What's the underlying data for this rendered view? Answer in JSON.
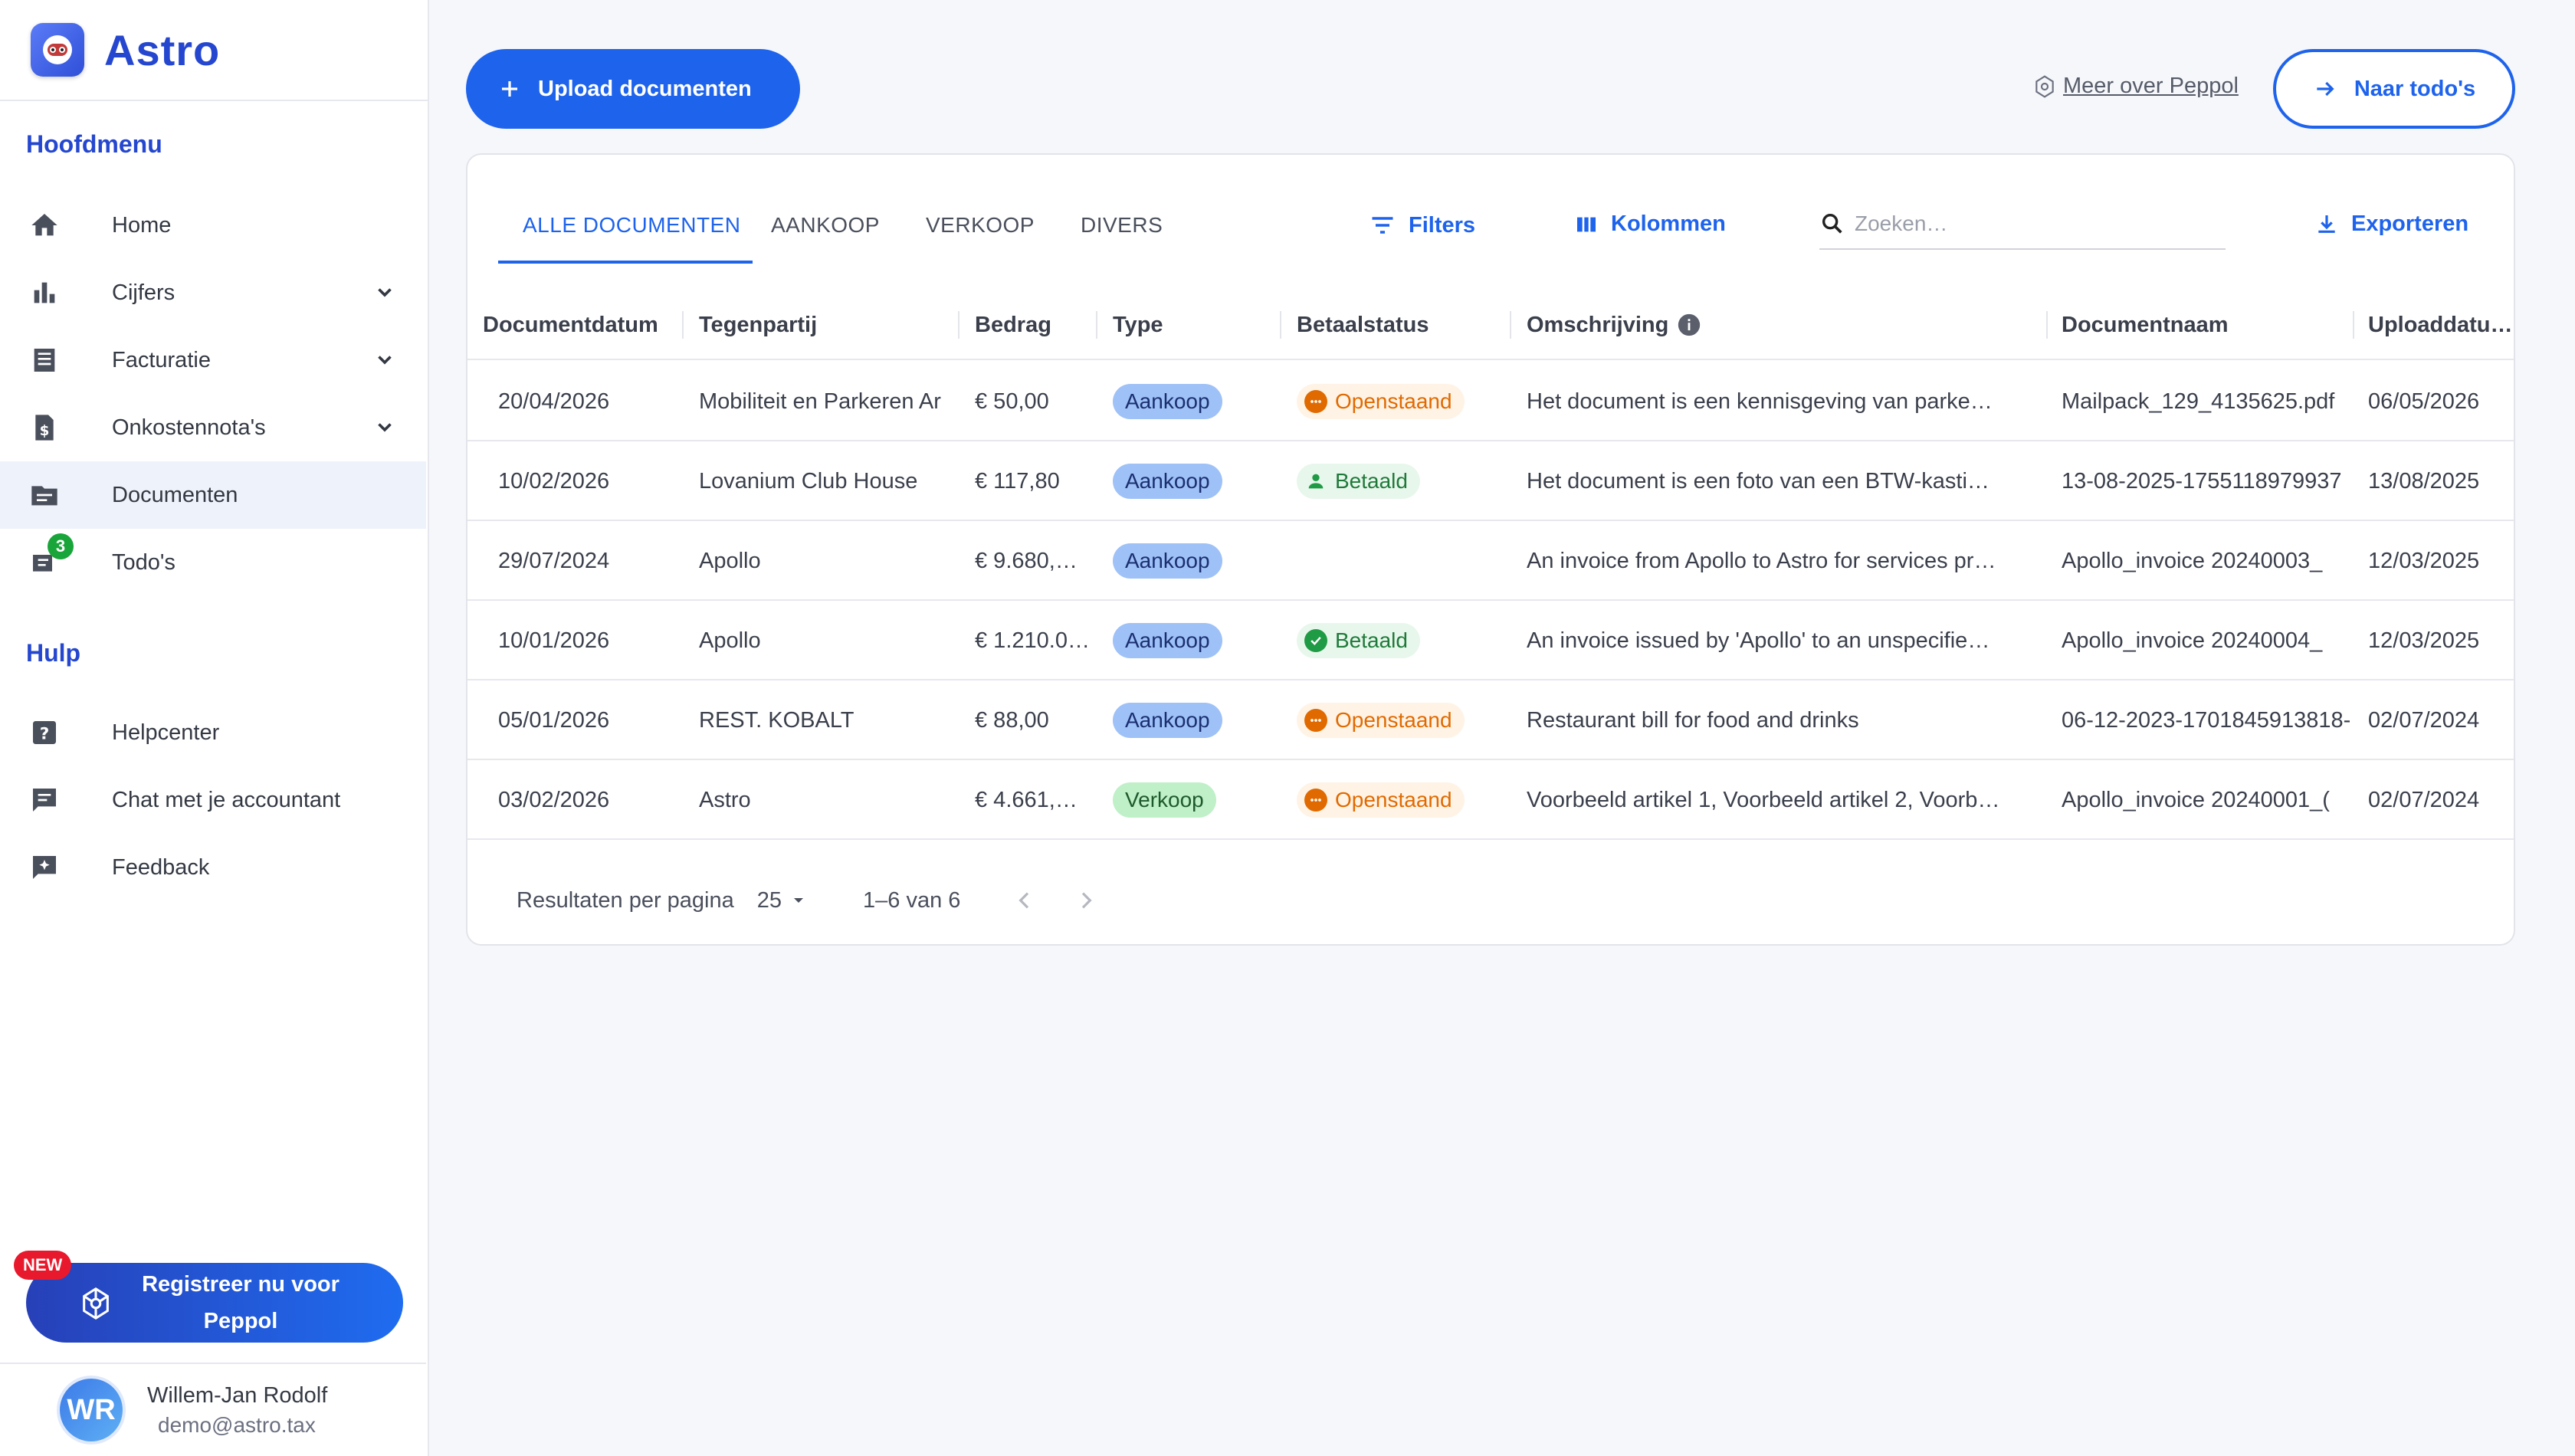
{
  "app": {
    "name": "Astro"
  },
  "sidebar": {
    "main_title": "Hoofdmenu",
    "items": [
      {
        "label": "Home",
        "icon": "home-icon"
      },
      {
        "label": "Cijfers",
        "icon": "bar-chart-icon"
      },
      {
        "label": "Facturatie",
        "icon": "invoice-icon"
      },
      {
        "label": "Onkostennota's",
        "icon": "receipt-icon"
      },
      {
        "label": "Documenten",
        "icon": "folder-icon"
      },
      {
        "label": "Todo's",
        "icon": "todo-icon",
        "badge": "3"
      }
    ],
    "help_title": "Hulp",
    "help_items": [
      {
        "label": "Helpcenter",
        "icon": "help-icon"
      },
      {
        "label": "Chat met je accountant",
        "icon": "chat-icon"
      },
      {
        "label": "Feedback",
        "icon": "feedback-icon"
      }
    ],
    "cta": {
      "new_badge": "NEW",
      "label": "Registreer nu voor Peppol"
    },
    "user": {
      "initials": "WR",
      "name": "Willem-Jan Rodolf",
      "email": "demo@astro.tax"
    }
  },
  "topbar": {
    "upload_label": "Upload documenten",
    "peppol_link": "Meer over Peppol",
    "todo_label": "Naar todo's"
  },
  "tabs": [
    "ALLE DOCUMENTEN",
    "AANKOOP",
    "VERKOOP",
    "DIVERS"
  ],
  "toolbar": {
    "filters_label": "Filters",
    "columns_label": "Kolommen",
    "search_placeholder": "Zoeken…",
    "export_label": "Exporteren"
  },
  "table": {
    "columns": [
      "Documentdatum",
      "Tegenpartij",
      "Bedrag",
      "Type",
      "Betaalstatus",
      "Omschrijving",
      "Documentnaam",
      "Uploaddatu…"
    ],
    "rows": [
      {
        "date": "20/04/2026",
        "party": "Mobiliteit en Parkeren Ar",
        "amount": "€ 50,00",
        "type": "Aankoop",
        "status": "Openstaand",
        "description": "Het document is een kennisgeving van parke…",
        "docname": "Mailpack_129_4135625.pdf",
        "upload": "06/05/2026"
      },
      {
        "date": "10/02/2026",
        "party": "Lovanium Club House",
        "amount": "€ 117,80",
        "type": "Aankoop",
        "status": "Betaald",
        "description": "Het document is een foto van een BTW-kasti…",
        "docname": "13-08-2025-1755118979937",
        "upload": "13/08/2025"
      },
      {
        "date": "29/07/2024",
        "party": "Apollo",
        "amount": "€ 9.680,…",
        "type": "Aankoop",
        "status": "",
        "description": "An invoice from Apollo to Astro for services pr…",
        "docname": "Apollo_invoice 20240003_",
        "upload": "12/03/2025"
      },
      {
        "date": "10/01/2026",
        "party": "Apollo",
        "amount": "€ 1.210.0…",
        "type": "Aankoop",
        "status": "Betaald",
        "description": "An invoice issued by 'Apollo' to an unspecifie…",
        "docname": "Apollo_invoice 20240004_",
        "upload": "12/03/2025"
      },
      {
        "date": "05/01/2026",
        "party": "REST. KOBALT",
        "amount": "€ 88,00",
        "type": "Aankoop",
        "status": "Openstaand",
        "description": "Restaurant bill for food and drinks",
        "docname": "06-12-2023-1701845913818-",
        "upload": "02/07/2024"
      },
      {
        "date": "03/02/2026",
        "party": "Astro",
        "amount": "€ 4.661,…",
        "type": "Verkoop",
        "status": "Openstaand",
        "description": "Voorbeeld artikel 1, Voorbeeld artikel 2, Voorb…",
        "docname": "Apollo_invoice 20240001_(",
        "upload": "02/07/2024"
      }
    ]
  },
  "pagination": {
    "per_page_label": "Resultaten per pagina",
    "per_page_value": "25",
    "range": "1–6 van 6"
  },
  "colors": {
    "accent": "#1e63ec",
    "brand": "#2547cf",
    "open": "#e06a00",
    "paid": "#1f7a3a"
  }
}
